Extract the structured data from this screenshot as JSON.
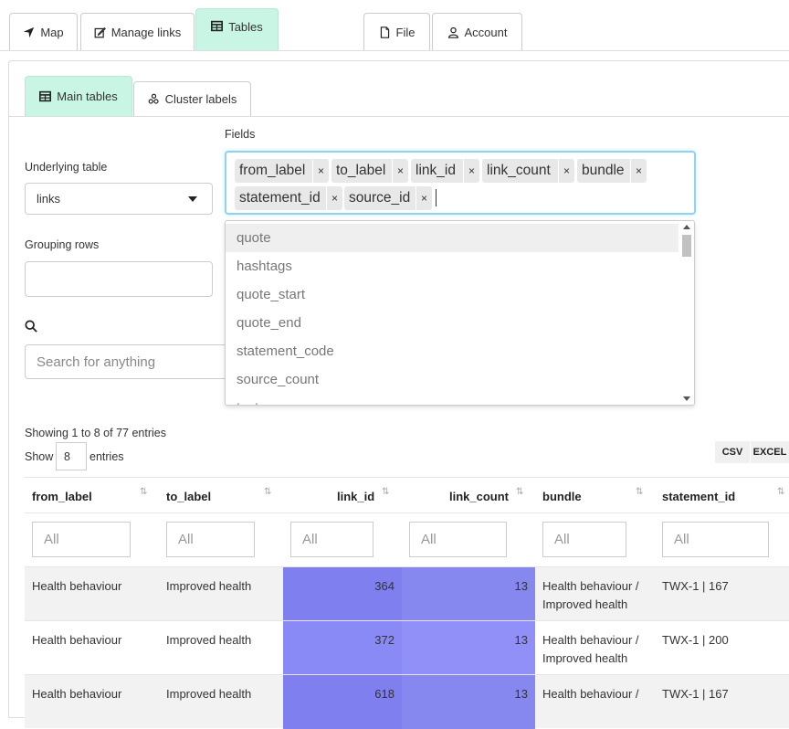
{
  "top_tabs": [
    {
      "label": "Map",
      "icon": "location-arrow-icon"
    },
    {
      "label": "Manage links",
      "icon": "edit-icon"
    },
    {
      "label": "Tables",
      "icon": "table-icon",
      "active": true
    },
    {
      "label": "File",
      "icon": "file-icon"
    },
    {
      "label": "Account",
      "icon": "user-icon"
    }
  ],
  "sub_tabs": [
    {
      "label": "Main tables",
      "icon": "table-icon",
      "active": true
    },
    {
      "label": "Cluster labels",
      "icon": "cluster-icon"
    }
  ],
  "controls": {
    "underlying_table_label": "Underlying table",
    "underlying_table_value": "links",
    "grouping_rows_label": "Grouping rows",
    "fields_label": "Fields",
    "search_placeholder": "Search for anything"
  },
  "fields_selected": [
    "from_label",
    "to_label",
    "link_id",
    "link_count",
    "bundle",
    "statement_id",
    "source_id"
  ],
  "fields_dropdown": [
    "quote",
    "hashtags",
    "quote_start",
    "quote_end",
    "statement_code",
    "source_count",
    "text"
  ],
  "table_info": {
    "showing": "Showing 1 to 8 of 77 entries",
    "show_label": "Show",
    "show_value": "8",
    "entries_label": "entries"
  },
  "export_buttons": [
    "CSV",
    "EXCEL"
  ],
  "table": {
    "columns": [
      "from_label",
      "to_label",
      "link_id",
      "link_count",
      "bundle",
      "statement_id"
    ],
    "filter_placeholder": "All",
    "rows": [
      {
        "from_label": "Health behaviour",
        "to_label": "Improved health",
        "link_id": "364",
        "link_count": "13",
        "bundle_1": "Health behaviour /",
        "bundle_2": "Improved health",
        "statement_id": "TWX-1 | 167"
      },
      {
        "from_label": "Health behaviour",
        "to_label": "Improved health",
        "link_id": "372",
        "link_count": "13",
        "bundle_1": "Health behaviour /",
        "bundle_2": "Improved health",
        "statement_id": "TWX-1 | 200"
      },
      {
        "from_label": "Health behaviour",
        "to_label": "Improved health",
        "link_id": "618",
        "link_count": "13",
        "bundle_1": "Health behaviour /",
        "bundle_2": "",
        "statement_id": "TWX-1 | 167"
      }
    ]
  },
  "colors": {
    "active_tab_bg": "#c8f5e4",
    "row_stripe": "#f2f2f2",
    "link_id_bar": "#8080f0",
    "link_count_bar": "#8888f0"
  }
}
